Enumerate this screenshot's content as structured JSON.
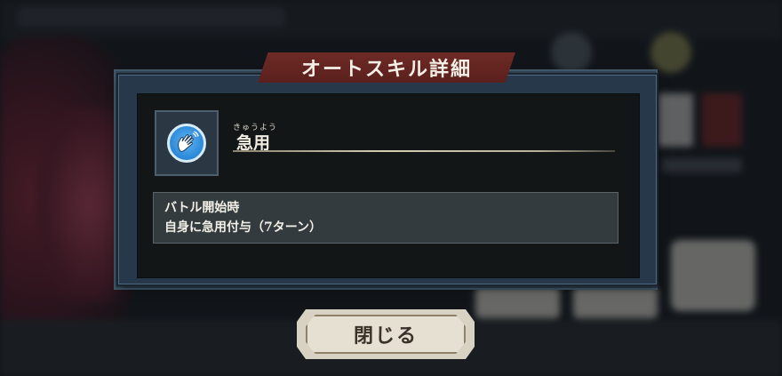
{
  "dialog": {
    "title": "オートスキル詳細",
    "skill": {
      "icon": "hand-icon",
      "ruby": "きゅうよう",
      "name": "急用"
    },
    "description": {
      "trigger": "バトル開始時",
      "effect": "自身に急用付与（7ターン）"
    },
    "close_label": "閉じる"
  },
  "colors": {
    "banner": "#6e2a26",
    "panel": "#27384a",
    "icon_blue": "#2a87d8",
    "button": "#e6e0d2"
  }
}
